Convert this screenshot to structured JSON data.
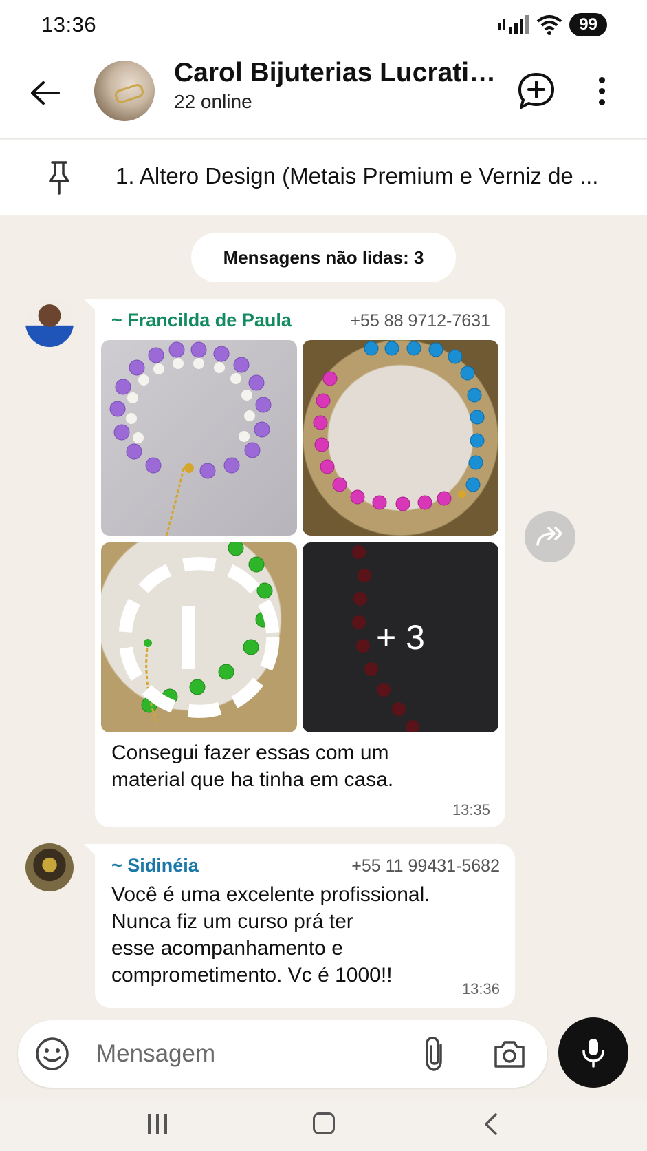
{
  "status_bar": {
    "time": "13:36",
    "battery": "99"
  },
  "header": {
    "title": "Carol Bijuterias Lucrativ...",
    "subtitle": "22 online"
  },
  "pinned": {
    "text": "1. Altero Design (Metais Premium e Verniz de ..."
  },
  "unread": {
    "label": "Mensagens não lidas: 3"
  },
  "messages": [
    {
      "sender": "~ Francilda de Paula",
      "phone": "+55 88 9712-7631",
      "more_count": "+ 3",
      "text": "Consegui fazer essas com um\nmaterial  que ha tinha em casa.",
      "time": "13:35"
    },
    {
      "sender": "~ Sidinéia",
      "phone": "+55 11 99431-5682",
      "text": "Você é uma excelente profissional.\nNunca fiz um curso prá ter\nesse acompanhamento e\ncomprometimento.  Vc é 1000!!",
      "time": "13:36"
    }
  ],
  "composer": {
    "placeholder": "Mensagem"
  },
  "colors": {
    "sender_1": "#138a5f",
    "sender_2": "#1a78a8",
    "chat_bg": "#f3efe8"
  }
}
